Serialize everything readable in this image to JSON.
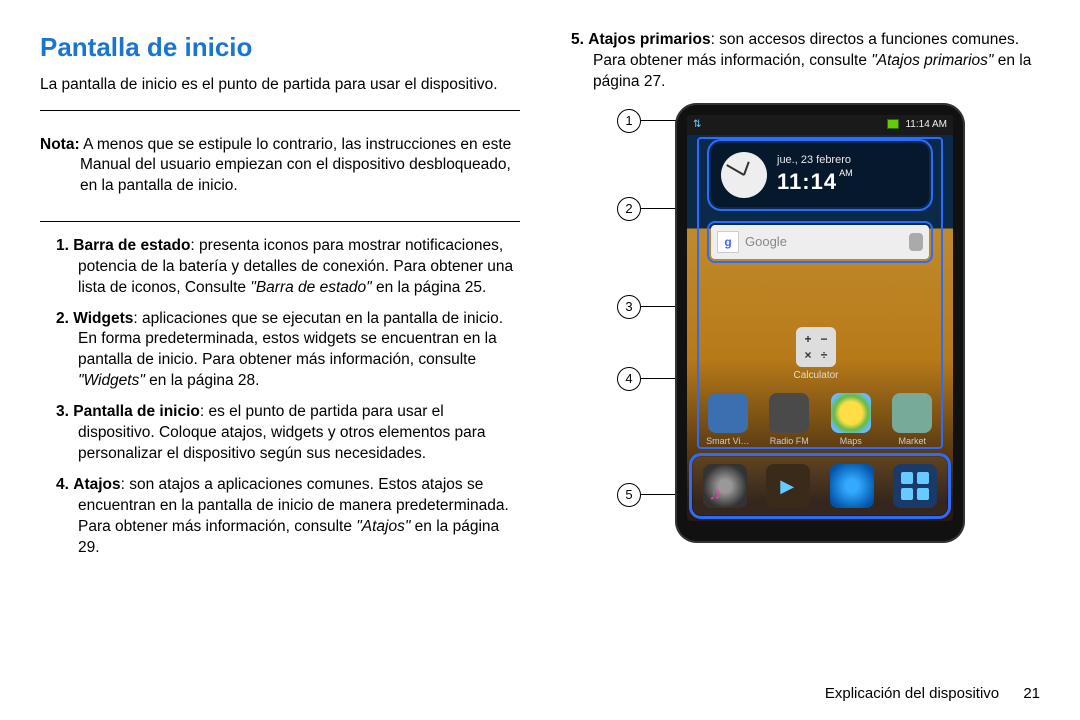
{
  "heading": "Pantalla de inicio",
  "intro": "La pantalla de inicio es el punto de partida para usar el dispositivo.",
  "note_label": "Nota:",
  "note_body": "A menos que se estipule lo contrario, las instrucciones en este Manual del usuario empiezan con el dispositivo desbloqueado, en la pantalla de inicio.",
  "items": {
    "i1": {
      "num": "1.",
      "term": "Barra de estado",
      "body": ": presenta iconos para mostrar notificaciones, potencia de la batería y detalles de conexión. Para obtener una lista de iconos, Consulte ",
      "ref": "\"Barra de estado\"",
      "tail": " en la página 25."
    },
    "i2": {
      "num": "2.",
      "term": "Widgets",
      "body": ": aplicaciones que se ejecutan en la pantalla de inicio. En forma predeterminada, estos widgets se encuentran en la pantalla de inicio. Para obtener más información, consulte ",
      "ref": "\"Widgets\"",
      "tail": " en la página 28."
    },
    "i3": {
      "num": "3.",
      "term": "Pantalla de inicio",
      "body": ": es el punto de partida para usar el dispositivo. Coloque atajos, widgets y otros elementos para personalizar el dispositivo según sus necesidades.",
      "ref": "",
      "tail": ""
    },
    "i4": {
      "num": "4.",
      "term": "Atajos",
      "body": ": son atajos a aplicaciones comunes. Estos atajos se encuentran en la pantalla de inicio de manera predeterminada. Para obtener más información, consulte ",
      "ref": "\"Atajos\"",
      "tail": " en la página 29."
    },
    "i5": {
      "num": "5.",
      "term": "Atajos primarios",
      "body": ": son accesos directos a funciones comunes. Para obtener más información, consulte ",
      "ref": "\"Atajos primarios\"",
      "tail": " en la página 27."
    }
  },
  "phone": {
    "status_time": "11:14 AM",
    "clock_date": "jue., 23 febrero",
    "clock_time": "11:14",
    "clock_ampm": "AM",
    "search_placeholder": "Google",
    "calc_label": "Calculator",
    "sc1": "Smart Vi…",
    "sc2": "Radio FM",
    "sc3": "Maps",
    "sc4": "Market"
  },
  "callouts": {
    "c1": "1",
    "c2": "2",
    "c3": "3",
    "c4": "4",
    "c5": "5"
  },
  "footer_section": "Explicación del dispositivo",
  "footer_page": "21"
}
